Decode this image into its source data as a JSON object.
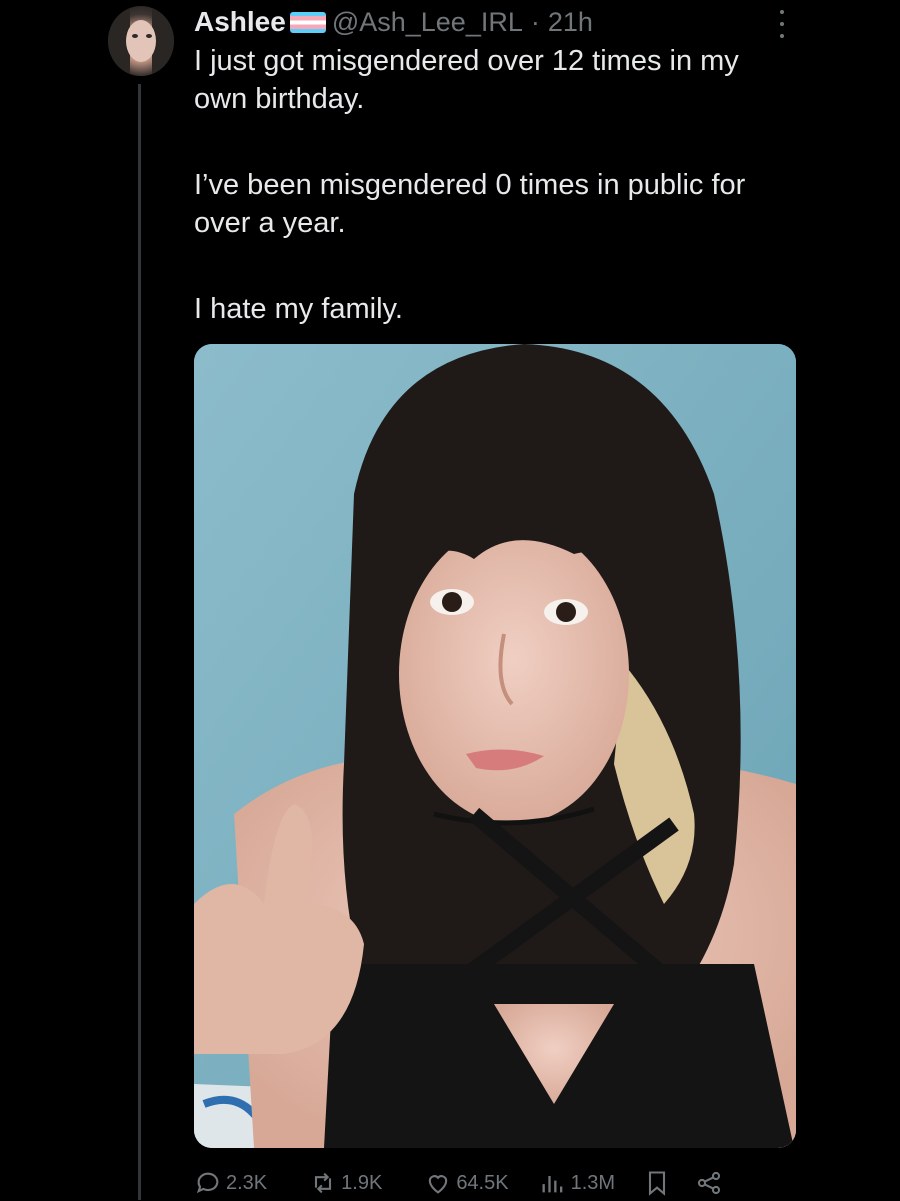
{
  "tweet": {
    "display_name": "Ashlee",
    "flag_icon": "transgender-flag-icon",
    "handle": "@Ash_Lee_IRL",
    "separator": "·",
    "time": "21h",
    "paragraphs": [
      "I just got misgendered over 12 times in my own birthday.",
      "I’ve been misgendered 0 times in public for over a year.",
      "I hate my family."
    ]
  },
  "metrics": {
    "replies": "2.3K",
    "reposts": "1.9K",
    "likes": "64.5K",
    "views": "1.3M"
  },
  "colors": {
    "background": "#000000",
    "text": "#e7e9ea",
    "muted": "#71767b",
    "thread_line": "#333639",
    "photo_wall": "#7fb3c2"
  },
  "icons": [
    "more-icon",
    "reply-icon",
    "repost-icon",
    "like-icon",
    "views-icon",
    "bookmark-icon",
    "share-icon"
  ]
}
